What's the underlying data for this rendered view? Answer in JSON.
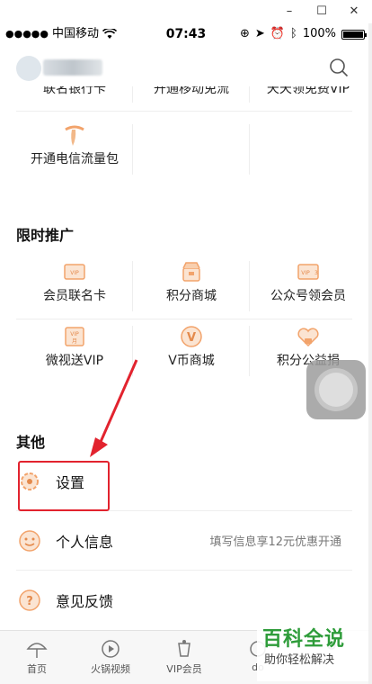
{
  "window": {
    "minimize": "–",
    "maximize": "☐",
    "close": "✕"
  },
  "status_bar": {
    "carrier": "中国移动",
    "time": "07:43",
    "battery": "100%"
  },
  "header": {
    "search_icon": "search-icon"
  },
  "top_partial_row": [
    "联名银行卡",
    "开通移动免流",
    "天天领免费VIP"
  ],
  "telecom": {
    "label": "开通电信流量包",
    "icon": "telecom-icon"
  },
  "promo": {
    "title": "限时推广",
    "items": [
      {
        "label": "会员联名卡",
        "icon": "vip-card-icon"
      },
      {
        "label": "积分商城",
        "icon": "points-mall-icon"
      },
      {
        "label": "公众号领会员",
        "icon": "official-account-icon"
      },
      {
        "label": "微视送VIP",
        "icon": "weishi-vip-icon"
      },
      {
        "label": "V币商城",
        "icon": "vcoin-icon"
      },
      {
        "label": "积分公益捐",
        "icon": "charity-icon"
      }
    ]
  },
  "other": {
    "title": "其他",
    "items": [
      {
        "label": "设置",
        "icon": "settings-icon",
        "hint": ""
      },
      {
        "label": "个人信息",
        "icon": "personal-info-icon",
        "hint": "填写信息享12元优惠开通"
      },
      {
        "label": "意见反馈",
        "icon": "feedback-icon",
        "hint": ""
      }
    ]
  },
  "bottom_nav": [
    {
      "label": "首页",
      "icon": "home-umbrella-icon"
    },
    {
      "label": "火锅视频",
      "icon": "video-icon"
    },
    {
      "label": "VIP会员",
      "icon": "vip-cup-icon"
    },
    {
      "label": "do",
      "icon": "doki-icon"
    },
    {
      "label": "",
      "icon": "profile-icon"
    }
  ],
  "watermark": {
    "line1": "百科全说",
    "line2": "助你轻松解决"
  },
  "colors": {
    "accent": "#f2a36b",
    "highlight": "#e2232e",
    "watermark": "#2e9c3a"
  }
}
